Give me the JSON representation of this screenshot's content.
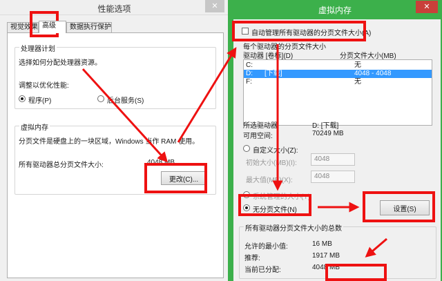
{
  "perf": {
    "title": "性能选项",
    "close": "✕",
    "tabs": [
      "视觉效果",
      "高级",
      "数据执行保护"
    ],
    "cpu": {
      "legend": "处理器计划",
      "desc": "选择如何分配处理器资源。",
      "optimize_label": "调整以优化性能:",
      "option_programs": "程序(P)",
      "option_services": "后台服务(S)"
    },
    "vm": {
      "legend": "虚拟内存",
      "desc": "分页文件是硬盘上的一块区域，Windows 当作 RAM 使用。",
      "total_label": "所有驱动器总分页文件大小:",
      "total_value": "4048 MB",
      "change_button": "更改(C)..."
    }
  },
  "vmdlg": {
    "title": "虚拟内存",
    "close": "✕",
    "auto_manage": "自动管理所有驱动器的分页文件大小(A)",
    "section_label": "每个驱动器的分页文件大小",
    "col_drive": "驱动器 [卷标](D)",
    "col_size": "分页文件大小(MB)",
    "drives": [
      {
        "drive": "C:",
        "label": "",
        "size": "无"
      },
      {
        "drive": "D:",
        "label": "[下载]",
        "size": "4048 - 4048"
      },
      {
        "drive": "F:",
        "label": "",
        "size": "无"
      }
    ],
    "selected_drive_label": "所选驱动器",
    "selected_drive_value": "D:  [下载]",
    "free_label": "可用空间:",
    "free_value": "70249 MB",
    "custom": "自定义大小(Z):",
    "initial_label": "初始大小(MB)(I):",
    "initial_value": "4048",
    "max_label": "最大值(MB)(X):",
    "max_value": "4048",
    "system_managed": "系统管理的大小(Y)",
    "no_paging": "无分页文件(N)",
    "set_button": "设置(S)",
    "totals_legend": "所有驱动器分页文件大小的总数",
    "min_label": "允许的最小值:",
    "min_value": "16 MB",
    "rec_label": "推荐:",
    "rec_value": "1917 MB",
    "cur_label": "当前已分配:",
    "cur_value": "4048 MB"
  },
  "colors": {
    "highlight": "#ee1111",
    "vm_frame": "#3cb04b",
    "selection": "#3399ff",
    "close_red": "#c9403a"
  }
}
